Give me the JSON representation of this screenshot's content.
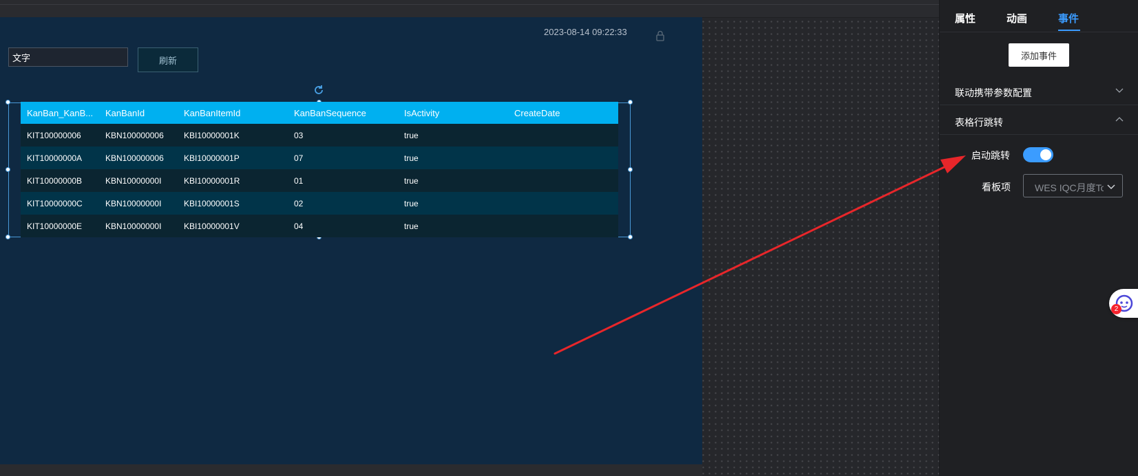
{
  "canvas": {
    "timestamp": "2023-08-14 09:22:33",
    "text_input_value": "文字",
    "refresh_label": "刷新"
  },
  "table": {
    "columns": [
      "KanBan_KanB...",
      "KanBanId",
      "KanBanItemId",
      "KanBanSequence",
      "IsActivity",
      "CreateDate"
    ],
    "rows": [
      [
        "KIT100000006",
        "KBN100000006",
        "KBI10000001K",
        "03",
        "true",
        ""
      ],
      [
        "KIT10000000A",
        "KBN100000006",
        "KBI10000001P",
        "07",
        "true",
        ""
      ],
      [
        "KIT10000000B",
        "KBN10000000I",
        "KBI10000001R",
        "01",
        "true",
        ""
      ],
      [
        "KIT10000000C",
        "KBN10000000I",
        "KBI10000001S",
        "02",
        "true",
        ""
      ],
      [
        "KIT10000000E",
        "KBN10000000I",
        "KBI10000001V",
        "04",
        "true",
        ""
      ]
    ]
  },
  "panel": {
    "tabs": [
      "属性",
      "动画",
      "事件"
    ],
    "active_tab": "事件",
    "add_event_label": "添加事件",
    "sections": {
      "linkage": "联动携带参数配置",
      "row_jump": "表格行跳转"
    },
    "enable_jump_label": "启动跳转",
    "enable_jump_on": true,
    "board_item_label": "看板项",
    "board_item_value": "WES IQC月度Top"
  },
  "assistant_badge_count": "2",
  "colors": {
    "accent": "#3b9cff",
    "table_header": "#00b0f0",
    "annotation_arrow": "#e8262a"
  }
}
